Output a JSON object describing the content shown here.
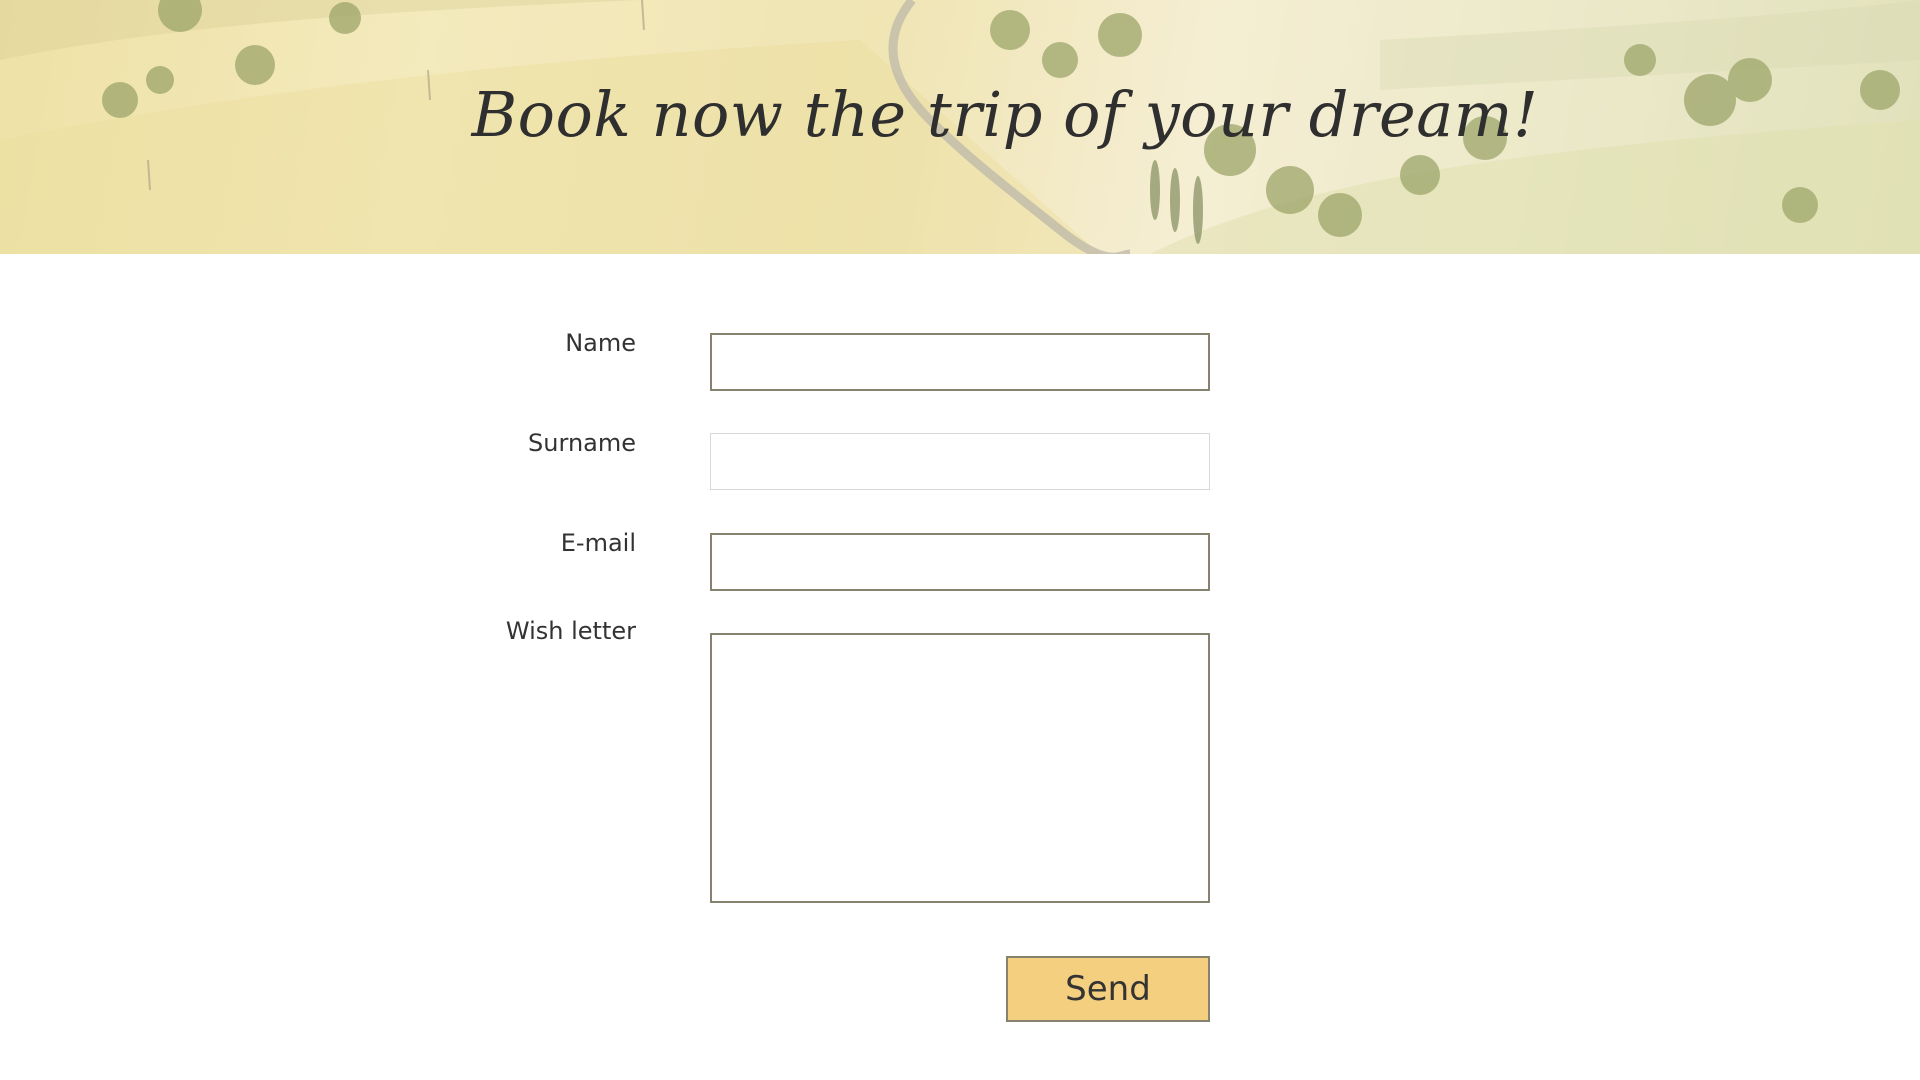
{
  "hero": {
    "title": "Book now the trip of your dream!"
  },
  "form": {
    "fields": [
      {
        "label": "Name",
        "value": ""
      },
      {
        "label": "Surname",
        "value": ""
      },
      {
        "label": "E-mail",
        "value": ""
      },
      {
        "label": "Wish letter",
        "value": ""
      }
    ],
    "submit_label": "Send"
  },
  "colors": {
    "button_fill": "#f5cf80",
    "field_border": "#86826d",
    "text": "#333333"
  }
}
